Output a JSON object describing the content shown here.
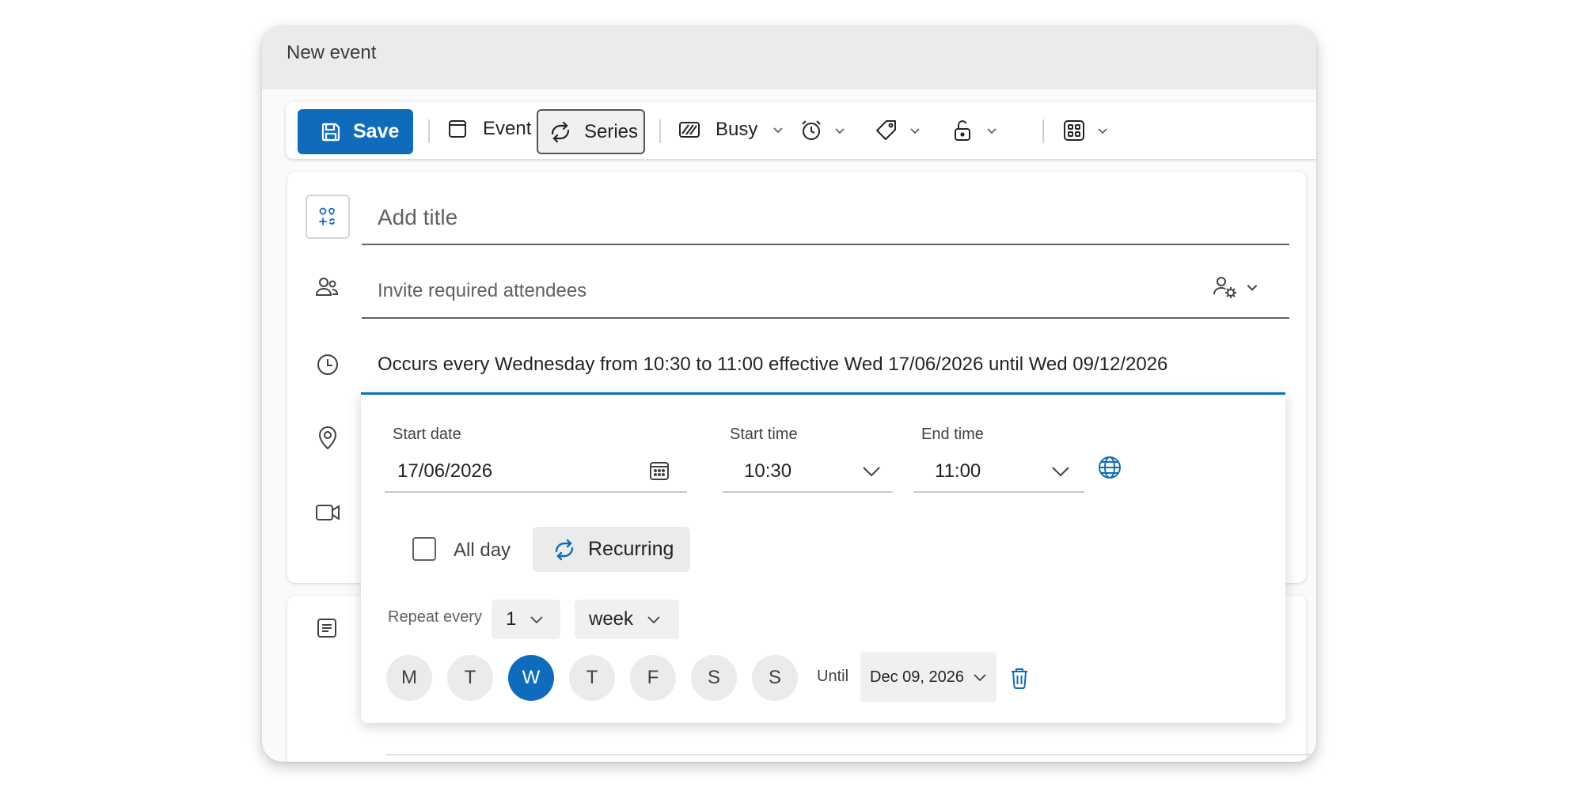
{
  "window": {
    "title": "New event"
  },
  "toolbar": {
    "save_label": "Save",
    "event_label": "Event",
    "series_label": "Series",
    "busy_label": "Busy"
  },
  "form": {
    "title_placeholder": "Add title",
    "attendees_placeholder": "Invite required attendees",
    "recurrence_summary": "Occurs every Wednesday from 10:30 to 11:00 effective Wed 17/06/2026 until Wed 09/12/2026"
  },
  "recurrence": {
    "start_date_label": "Start date",
    "start_date_value": "17/06/2026",
    "start_time_label": "Start time",
    "start_time_value": "10:30",
    "end_time_label": "End time",
    "end_time_value": "11:00",
    "all_day_label": "All day",
    "all_day_checked": false,
    "recurring_label": "Recurring",
    "repeat_every_label": "Repeat every",
    "repeat_interval": "1",
    "repeat_unit": "week",
    "days": [
      {
        "label": "M",
        "selected": false
      },
      {
        "label": "T",
        "selected": false
      },
      {
        "label": "W",
        "selected": true
      },
      {
        "label": "T",
        "selected": false
      },
      {
        "label": "F",
        "selected": false
      },
      {
        "label": "S",
        "selected": false
      },
      {
        "label": "S",
        "selected": false
      }
    ],
    "until_label": "Until",
    "until_value": "Dec 09, 2026"
  },
  "colors": {
    "accent": "#0f6cbd",
    "placeholder_text": "#616161",
    "pill_background": "#f0f0f0"
  },
  "icons": [
    "save-icon",
    "calendar-icon",
    "repeat-icon",
    "busy-icon",
    "alarm-icon",
    "tag-icon",
    "lock-icon",
    "apps-icon",
    "chevron-down-icon",
    "copilot-icon",
    "people-icon",
    "clock-icon",
    "location-icon",
    "video-icon",
    "notes-icon",
    "attendee-settings-icon",
    "globe-icon",
    "delete-icon"
  ]
}
